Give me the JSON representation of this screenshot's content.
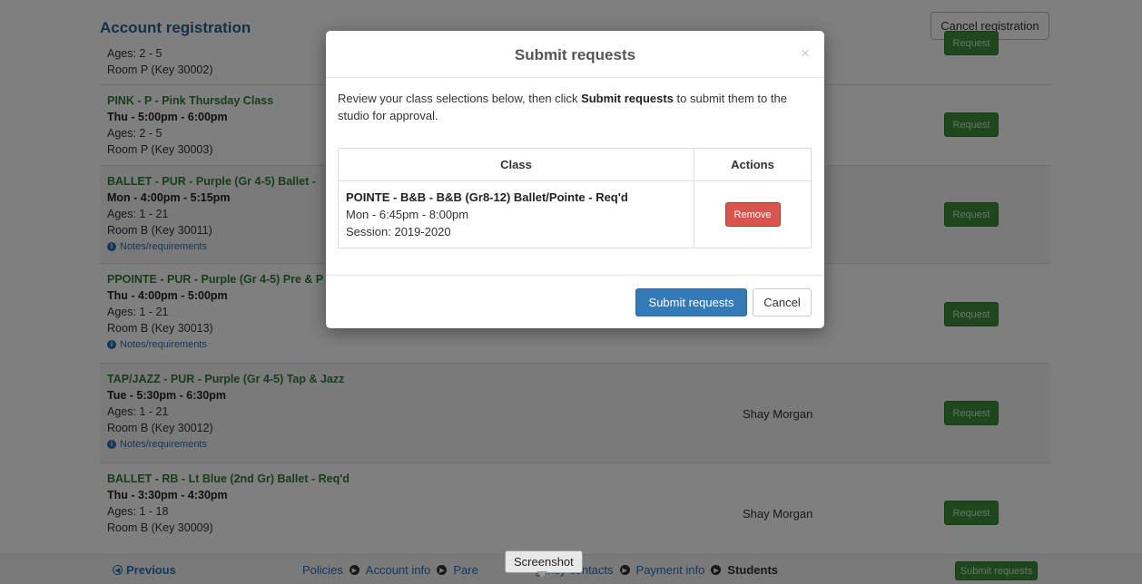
{
  "page": {
    "title": "Account registration",
    "cancel_registration": "Cancel registration"
  },
  "classes": [
    {
      "title": "",
      "schedule": "",
      "ages": "Ages: 2 - 5",
      "room": "Room P (Key 30002)",
      "notes": "",
      "teacher": "",
      "request_label": "Request"
    },
    {
      "title": "PINK - P - Pink Thursday Class",
      "schedule": "Thu - 5:00pm - 6:00pm",
      "ages": "Ages: 2 - 5",
      "room": "Room P (Key 30003)",
      "notes": "",
      "teacher": "",
      "request_label": "Request"
    },
    {
      "title": "BALLET - PUR - Purple (Gr 4-5) Ballet -",
      "schedule": "Mon - 4:00pm - 5:15pm",
      "ages": "Ages: 1 - 21",
      "room": "Room B (Key 30011)",
      "notes": "Notes/requirements",
      "teacher": "",
      "request_label": "Request"
    },
    {
      "title": "PPOINTE - PUR - Purple (Gr 4-5) Pre & P",
      "schedule": "Thu - 4:00pm - 5:00pm",
      "ages": "Ages: 1 - 21",
      "room": "Room B (Key 30013)",
      "notes": "Notes/requirements",
      "teacher": "",
      "request_label": "Request"
    },
    {
      "title": "TAP/JAZZ - PUR - Purple (Gr 4-5) Tap & Jazz",
      "schedule": "Tue - 5:30pm - 6:30pm",
      "ages": "Ages: 1 - 21",
      "room": "Room B (Key 30012)",
      "notes": "Notes/requirements",
      "teacher": "Shay Morgan",
      "request_label": "Request"
    },
    {
      "title": "BALLET - RB - Lt Blue (2nd Gr) Ballet - Req'd",
      "schedule": "Thu - 3:30pm - 4:30pm",
      "ages": "Ages: 1 - 18",
      "room": "Room B (Key 30009)",
      "notes": "",
      "teacher": "Shay Morgan",
      "request_label": "Request"
    }
  ],
  "bottom_bar": {
    "previous": "Previous",
    "steps": [
      "Policies",
      "Account info",
      "Pare",
      "gency contacts",
      "Payment info",
      "Students"
    ],
    "submit_requests": "Submit requests"
  },
  "modal": {
    "title": "Submit requests",
    "close": "×",
    "intro_before": "Review your class selections below, then click ",
    "intro_bold": "Submit requests",
    "intro_after": " to submit them to the studio for approval.",
    "table_headers": [
      "Class",
      "Actions"
    ],
    "selection": {
      "title": "POINTE - B&B - B&B (Gr8-12) Ballet/Pointe - Req'd",
      "schedule": "Mon - 6:45pm - 8:00pm",
      "session": "Session: 2019-2020",
      "remove_label": "Remove"
    },
    "submit_label": "Submit requests",
    "cancel_label": "Cancel"
  },
  "tooltip": "Screenshot",
  "colors": {
    "brand_blue": "#2a5f8f",
    "class_green": "#2e7d32",
    "request_green": "#3c8f3c",
    "primary_blue": "#337ab7",
    "danger_red": "#d9534f"
  }
}
